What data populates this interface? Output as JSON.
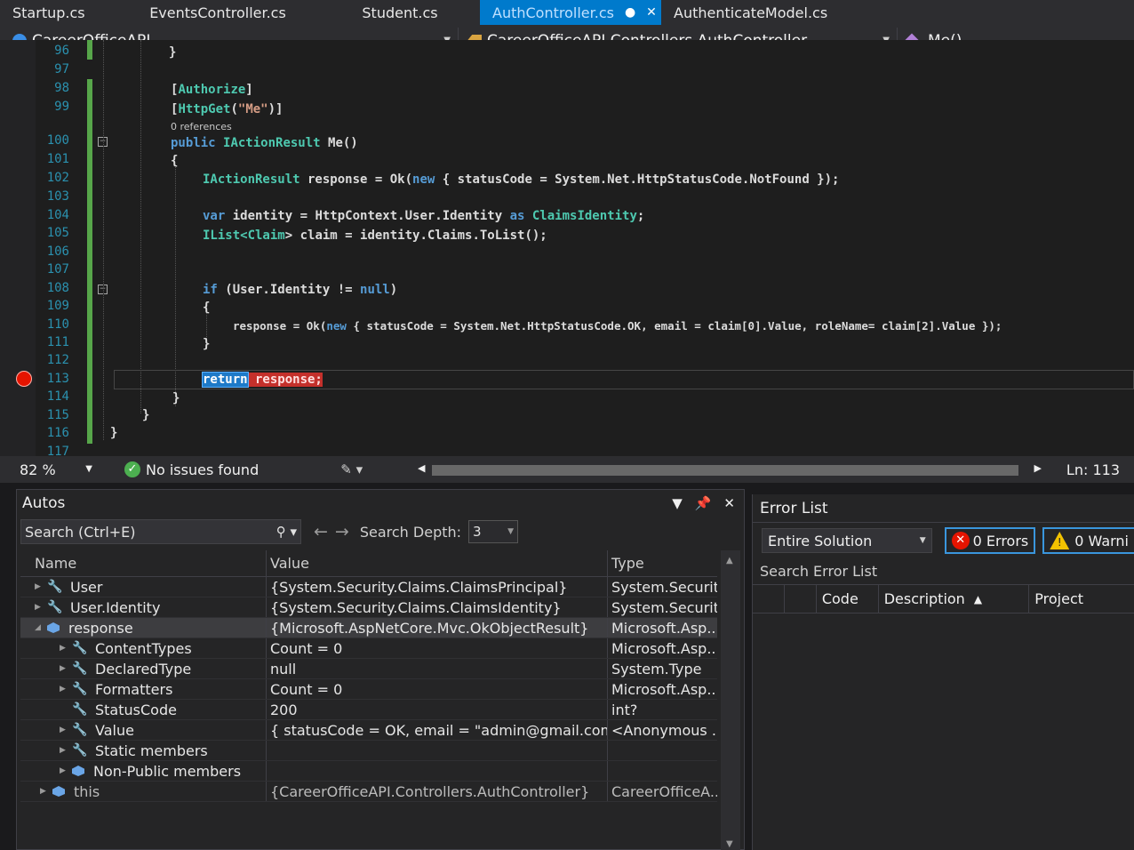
{
  "tabs": [
    {
      "label": "Startup.cs",
      "active": false
    },
    {
      "label": "EventsController.cs",
      "active": false
    },
    {
      "label": "Student.cs",
      "active": false
    },
    {
      "label": "AuthController.cs",
      "active": true
    },
    {
      "label": "AuthenticateModel.cs",
      "active": false
    }
  ],
  "navbar": {
    "project": "CareerOfficeAPI",
    "class": "CareerOfficeAPI.Controllers.AuthController",
    "member": "Me()"
  },
  "editor": {
    "line_numbers": [
      "96",
      "97",
      "98",
      "99",
      "100",
      "101",
      "102",
      "103",
      "104",
      "105",
      "106",
      "107",
      "108",
      "109",
      "110",
      "111",
      "112",
      "113",
      "114",
      "115",
      "116",
      "117"
    ],
    "codelens": "0 references",
    "lines": {
      "l96": "}",
      "l98a": "[",
      "l98b": "Authorize",
      "l98c": "]",
      "l99a": "[",
      "l99b": "HttpGet",
      "l99c": "(",
      "l99d": "\"Me\"",
      "l99e": ")]",
      "l100a": "public ",
      "l100b": "IActionResult",
      "l100c": " Me()",
      "l101": "{",
      "l102a": "IActionResult",
      "l102b": " response = Ok(",
      "l102c": "new",
      "l102d": " { statusCode = System.Net.HttpStatusCode.NotFound });",
      "l104a": "var",
      "l104b": " identity = HttpContext.User.Identity ",
      "l104c": "as",
      "l104d": " ClaimsIdentity",
      "l104e": ";",
      "l105a": "IList<",
      "l105b": "Claim",
      "l105c": "> claim = identity.Claims.ToList();",
      "l108a": "if",
      "l108b": " (User.Identity != ",
      "l108c": "null",
      "l108d": ")",
      "l109": "{",
      "l110a": "response = Ok(",
      "l110b": "new",
      "l110c": " { statusCode = System.Net.HttpStatusCode.OK, email = claim[0].Value, roleName= claim[2].Value });",
      "l111": "}",
      "l113a": "return",
      "l113b": " response;",
      "l114": "}",
      "l115": "}",
      "l116": "}"
    }
  },
  "status": {
    "zoom": "82 %",
    "issues": "No issues found",
    "line_pos": "Ln: 113"
  },
  "autos": {
    "title": "Autos",
    "search_placeholder": "Search (Ctrl+E)",
    "depth_label": "Search Depth:",
    "depth_value": "3",
    "columns": {
      "name": "Name",
      "value": "Value",
      "type": "Type"
    },
    "rows": [
      {
        "name": "User",
        "value": "{System.Security.Claims.ClaimsPrincipal}",
        "type": "System.Securit..."
      },
      {
        "name": "User.Identity",
        "value": "{System.Security.Claims.ClaimsIdentity}",
        "type": "System.Securit..."
      },
      {
        "name": "response",
        "value": "{Microsoft.AspNetCore.Mvc.OkObjectResult}",
        "type": "Microsoft.Asp..."
      },
      {
        "name": "ContentTypes",
        "value": "Count = 0",
        "type": "Microsoft.Asp..."
      },
      {
        "name": "DeclaredType",
        "value": "null",
        "type": "System.Type"
      },
      {
        "name": "Formatters",
        "value": "Count = 0",
        "type": "Microsoft.Asp..."
      },
      {
        "name": "StatusCode",
        "value": "200",
        "type": "int?"
      },
      {
        "name": "Value",
        "value": "{ statusCode = OK, email = \"admin@gmail.com\", ...",
        "type": "<Anonymous ..."
      },
      {
        "name": "Static members",
        "value": "",
        "type": ""
      },
      {
        "name": "Non-Public members",
        "value": "",
        "type": ""
      },
      {
        "name": "this",
        "value": "{CareerOfficeAPI.Controllers.AuthController}",
        "type": "CareerOfficeA..."
      }
    ]
  },
  "errorlist": {
    "title": "Error List",
    "scope": "Entire Solution",
    "errors": "0 Errors",
    "warnings": "0 Warni",
    "search_placeholder": "Search Error List",
    "columns": {
      "code": "Code",
      "description": "Description",
      "project": "Project"
    }
  },
  "colors": {
    "accent": "#007acc",
    "breakpoint": "#e51400",
    "keyword": "#569cd6",
    "type": "#4ec9b0",
    "string": "#d69d85"
  }
}
